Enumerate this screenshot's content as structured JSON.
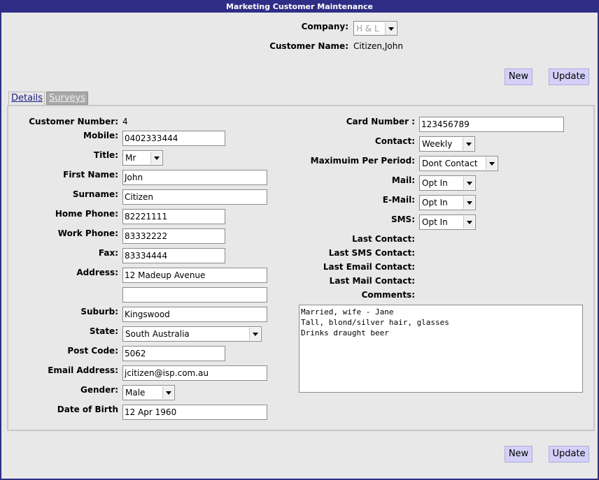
{
  "window": {
    "title": "Marketing Customer Maintenance"
  },
  "header": {
    "company_label": "Company:",
    "company_value": "H & L",
    "customer_name_label": "Customer Name:",
    "customer_name_value": "Citizen,John"
  },
  "buttons": {
    "new": "New",
    "update": "Update"
  },
  "tabs": [
    {
      "label": "Details"
    },
    {
      "label": "Surveys"
    }
  ],
  "left": {
    "customer_number_label": "Customer Number:",
    "customer_number_value": "4",
    "mobile_label": "Mobile:",
    "mobile_value": "0402333444",
    "title_label": "Title:",
    "title_value": "Mr",
    "first_name_label": "First Name:",
    "first_name_value": "John",
    "surname_label": "Surname:",
    "surname_value": "Citizen",
    "home_phone_label": "Home Phone:",
    "home_phone_value": "82221111",
    "work_phone_label": "Work Phone:",
    "work_phone_value": "83332222",
    "fax_label": "Fax:",
    "fax_value": "83334444",
    "address_label": "Address:",
    "address_line1": "12 Madeup Avenue",
    "address_line2": "",
    "suburb_label": "Suburb:",
    "suburb_value": "Kingswood",
    "state_label": "State:",
    "state_value": "South Australia",
    "post_code_label": "Post Code:",
    "post_code_value": "5062",
    "email_label": "Email Address:",
    "email_value": "jcitizen@isp.com.au",
    "gender_label": "Gender:",
    "gender_value": "Male",
    "dob_label": "Date of Birth",
    "dob_value": "12 Apr 1960"
  },
  "right": {
    "card_number_label": "Card Number :",
    "card_number_value": "123456789",
    "contact_label": "Contact:",
    "contact_value": "Weekly",
    "max_per_period_label": "Maximuim Per Period:",
    "max_per_period_value": "Dont Contact",
    "mail_label": "Mail:",
    "mail_value": "Opt In",
    "email_label": "E-Mail:",
    "email_value": "Opt In",
    "sms_label": "SMS:",
    "sms_value": "Opt In",
    "last_contact_label": "Last Contact:",
    "last_sms_contact_label": "Last SMS Contact:",
    "last_email_contact_label": "Last Email Contact:",
    "last_mail_contact_label": "Last Mail Contact:",
    "comments_label": "Comments:",
    "comments_value": "Married, wife - Jane\nTall, blond/silver hair, glasses\nDrinks draught beer"
  }
}
